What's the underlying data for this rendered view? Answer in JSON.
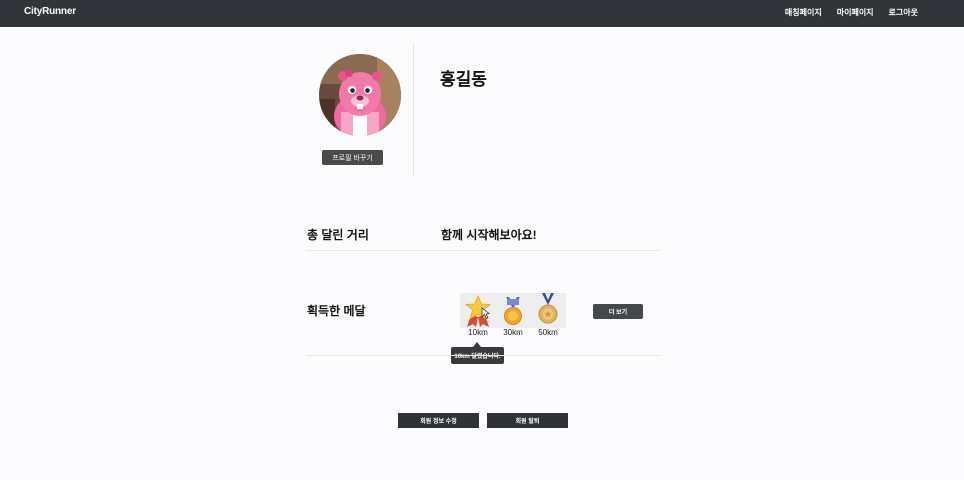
{
  "navbar": {
    "brand": "CityRunner",
    "links": [
      "매칭페이지",
      "마이페이지",
      "로그아웃"
    ]
  },
  "profile": {
    "change_button": "프로필 바꾸기",
    "name": "홍길동"
  },
  "distance": {
    "label": "총 달린 거리",
    "value": "함께 시작해보아요!"
  },
  "medals": {
    "label": "획득한 메달",
    "items": [
      "10km",
      "30km",
      "50km"
    ],
    "more_button": "더 보기",
    "tooltip": "10km 달렸습니다."
  },
  "actions": {
    "edit_button": "회원 정보 수정",
    "withdraw_button": "회원 탈퇴"
  }
}
